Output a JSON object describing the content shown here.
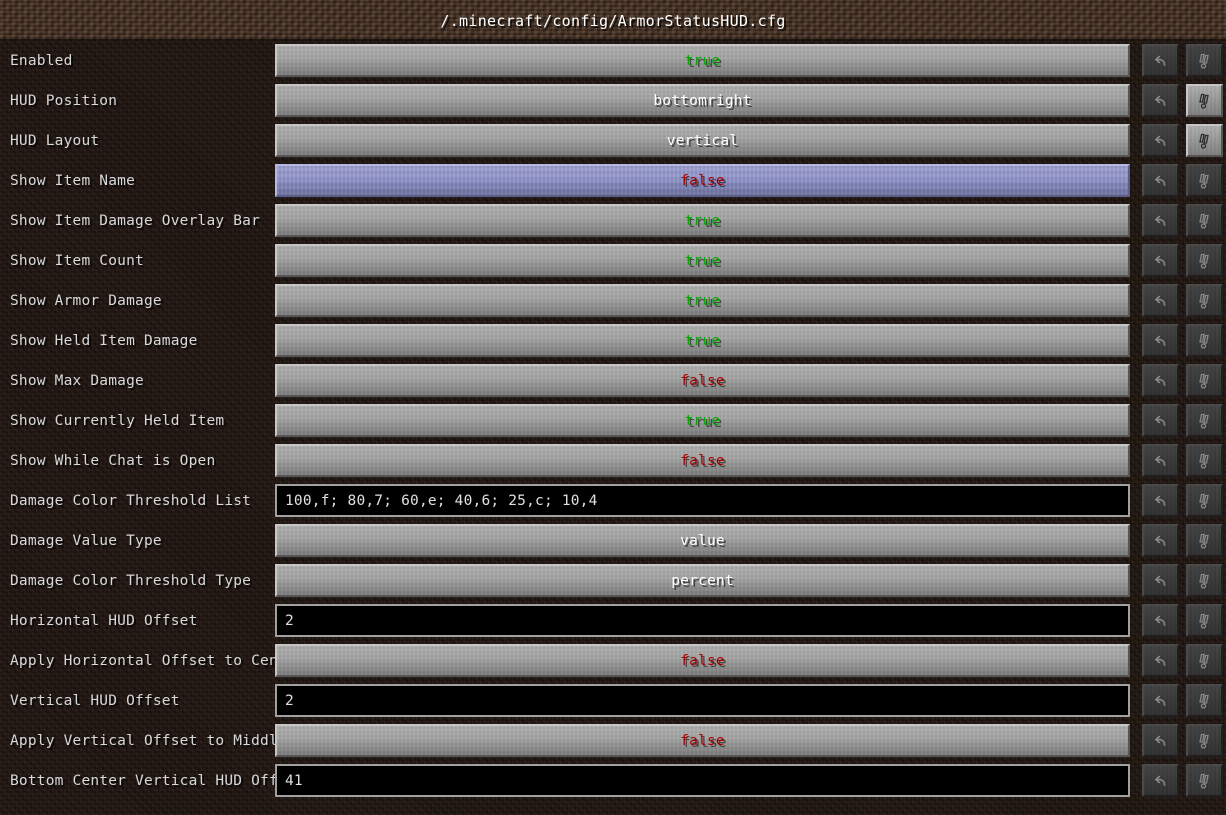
{
  "window": {
    "title": "/.minecraft/config/ArmorStatusHUD.cfg"
  },
  "colors": {
    "true_value": "#00a800",
    "false_value": "#aa0000",
    "text_value": "#ffffff",
    "selected_row": "#8d91c9",
    "button_face": "#a0a0a0",
    "title_bar": "#3a2a20",
    "background": "#1b1310"
  },
  "icons": {
    "undo": "undo-arrow-icon",
    "reset": "reset-default-icon"
  },
  "rows": [
    {
      "label": "Enabled",
      "type": "button",
      "value": "true",
      "value_kind": "true",
      "selected": false,
      "undo_enabled": false,
      "reset_enabled": false
    },
    {
      "label": "HUD Position",
      "type": "button",
      "value": "bottomright",
      "value_kind": "text",
      "selected": false,
      "undo_enabled": false,
      "reset_enabled": true
    },
    {
      "label": "HUD Layout",
      "type": "button",
      "value": "vertical",
      "value_kind": "text",
      "selected": false,
      "undo_enabled": false,
      "reset_enabled": true
    },
    {
      "label": "Show Item Name",
      "type": "button",
      "value": "false",
      "value_kind": "false",
      "selected": true,
      "undo_enabled": false,
      "reset_enabled": false
    },
    {
      "label": "Show Item Damage Overlay Bar",
      "type": "button",
      "value": "true",
      "value_kind": "true",
      "selected": false,
      "undo_enabled": false,
      "reset_enabled": false
    },
    {
      "label": "Show Item Count",
      "type": "button",
      "value": "true",
      "value_kind": "true",
      "selected": false,
      "undo_enabled": false,
      "reset_enabled": false
    },
    {
      "label": "Show Armor Damage",
      "type": "button",
      "value": "true",
      "value_kind": "true",
      "selected": false,
      "undo_enabled": false,
      "reset_enabled": false
    },
    {
      "label": "Show Held Item Damage",
      "type": "button",
      "value": "true",
      "value_kind": "true",
      "selected": false,
      "undo_enabled": false,
      "reset_enabled": false
    },
    {
      "label": "Show Max Damage",
      "type": "button",
      "value": "false",
      "value_kind": "false",
      "selected": false,
      "undo_enabled": false,
      "reset_enabled": false
    },
    {
      "label": "Show Currently Held Item",
      "type": "button",
      "value": "true",
      "value_kind": "true",
      "selected": false,
      "undo_enabled": false,
      "reset_enabled": false
    },
    {
      "label": "Show While Chat is Open",
      "type": "button",
      "value": "false",
      "value_kind": "false",
      "selected": false,
      "undo_enabled": false,
      "reset_enabled": false
    },
    {
      "label": "Damage Color Threshold List",
      "type": "textfield",
      "value": "100,f; 80,7; 60,e; 40,6; 25,c; 10,4",
      "value_kind": "text",
      "selected": false,
      "undo_enabled": false,
      "reset_enabled": false
    },
    {
      "label": "Damage Value Type",
      "type": "button",
      "value": "value",
      "value_kind": "text",
      "selected": false,
      "undo_enabled": false,
      "reset_enabled": false
    },
    {
      "label": "Damage Color Threshold Type",
      "type": "button",
      "value": "percent",
      "value_kind": "text",
      "selected": false,
      "undo_enabled": false,
      "reset_enabled": false
    },
    {
      "label": "Horizontal HUD Offset",
      "type": "textfield",
      "value": "2",
      "value_kind": "text",
      "selected": false,
      "undo_enabled": false,
      "reset_enabled": false
    },
    {
      "label": "Apply Horizontal Offset to Center",
      "type": "button",
      "value": "false",
      "value_kind": "false",
      "selected": false,
      "undo_enabled": false,
      "reset_enabled": false
    },
    {
      "label": "Vertical HUD Offset",
      "type": "textfield",
      "value": "2",
      "value_kind": "text",
      "selected": false,
      "undo_enabled": false,
      "reset_enabled": false
    },
    {
      "label": "Apply Vertical Offset to Middle",
      "type": "button",
      "value": "false",
      "value_kind": "false",
      "selected": false,
      "undo_enabled": false,
      "reset_enabled": false
    },
    {
      "label": "Bottom Center Vertical HUD Offset",
      "type": "textfield",
      "value": "41",
      "value_kind": "text",
      "selected": false,
      "undo_enabled": false,
      "reset_enabled": false
    }
  ]
}
